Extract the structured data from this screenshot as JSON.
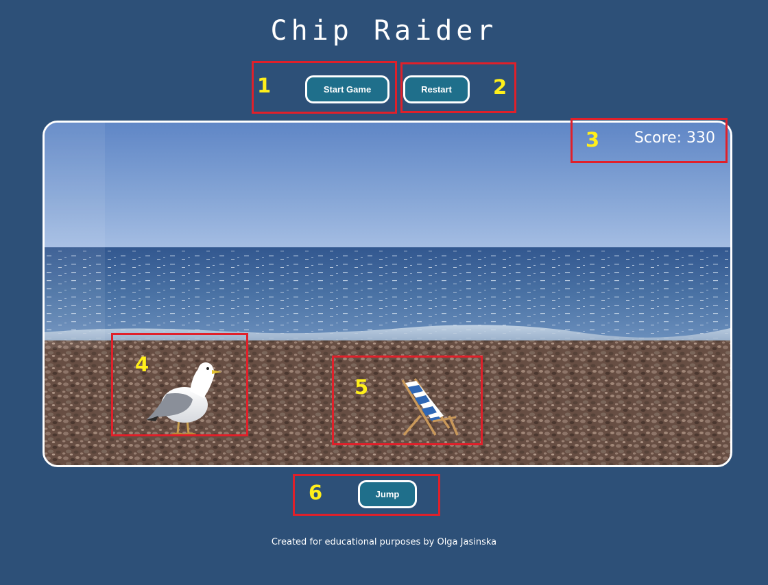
{
  "page": {
    "title": "Chip Raider",
    "footer": "Created for educational purposes by Olga Jasinska"
  },
  "controls": {
    "start_label": "Start Game",
    "restart_label": "Restart",
    "jump_label": "Jump"
  },
  "game": {
    "score_label": "Score:",
    "score_value": "330",
    "player": "seagull-icon",
    "obstacle": "deckchair-icon"
  },
  "annotations": {
    "start": "1",
    "restart": "2",
    "score": "3",
    "player": "4",
    "obstacle": "5",
    "jump": "6"
  },
  "colors": {
    "background": "#2d5078",
    "button": "#1f6f8b",
    "annotation_box": "#e0202a",
    "annotation_number": "#ffef1a"
  }
}
